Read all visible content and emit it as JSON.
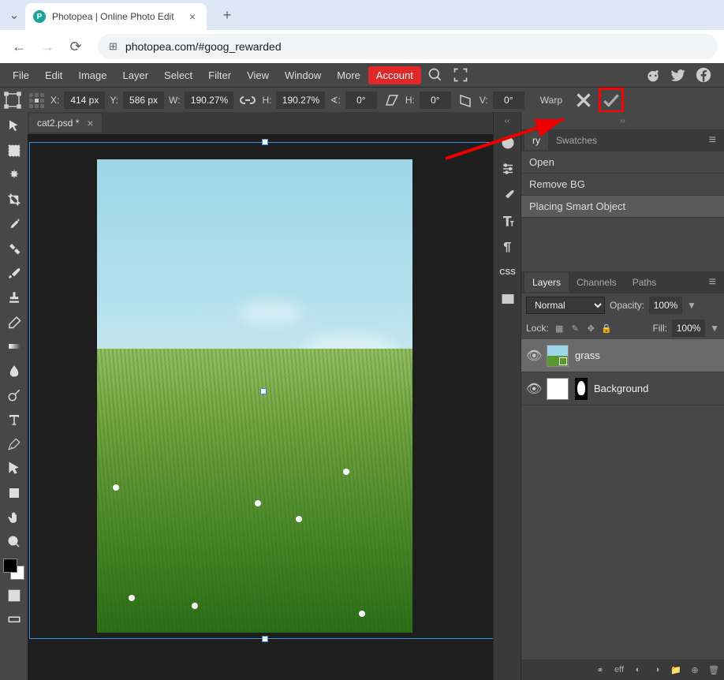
{
  "browser": {
    "tab_title": "Photopea | Online Photo Edit",
    "url": "photopea.com/#goog_rewarded"
  },
  "menu": {
    "items": [
      "File",
      "Edit",
      "Image",
      "Layer",
      "Select",
      "Filter",
      "View",
      "Window",
      "More"
    ],
    "account": "Account"
  },
  "options": {
    "x_label": "X:",
    "x": "414 px",
    "y_label": "Y:",
    "y": "586 px",
    "w_label": "W:",
    "w": "190.27%",
    "h_label": "H:",
    "h": "190.27%",
    "angle_label": "∢:",
    "angle": "0°",
    "skew_h_label": "H:",
    "skew_h": "0°",
    "skew_v_label": "V:",
    "skew_v": "0°",
    "warp": "Warp"
  },
  "file_tab": {
    "name": "cat2.psd *"
  },
  "history": {
    "tab_truncated": "ry",
    "tab_swatches": "Swatches",
    "items": [
      "Open",
      "Remove BG",
      "Placing Smart Object"
    ]
  },
  "layers_panel": {
    "tab_layers": "Layers",
    "tab_channels": "Channels",
    "tab_paths": "Paths",
    "blend_mode": "Normal",
    "opacity_label": "Opacity:",
    "opacity": "100%",
    "lock_label": "Lock:",
    "fill_label": "Fill:",
    "fill": "100%",
    "layers": [
      {
        "name": "grass",
        "active": true
      },
      {
        "name": "Background",
        "active": false
      }
    ],
    "footer_eff": "eff"
  },
  "side_strip": {
    "css": "CSS"
  }
}
